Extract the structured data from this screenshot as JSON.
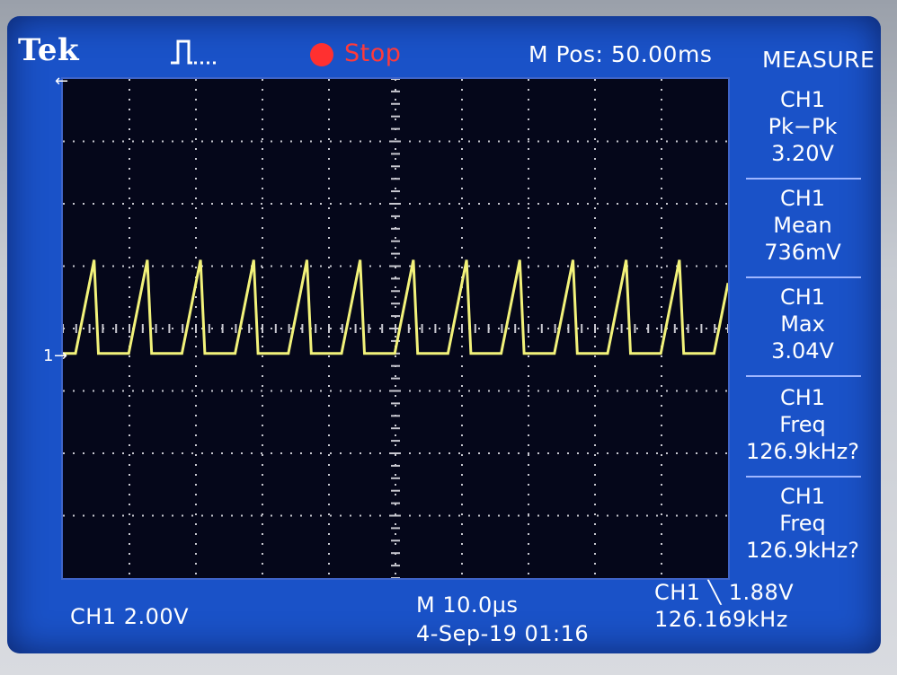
{
  "header": {
    "brand": "Tek",
    "trigger_icon": "pulse-trigger-icon",
    "run_status": "Stop",
    "m_pos": "M Pos: 50.00ms",
    "menu_title": "MEASURE"
  },
  "colors": {
    "screen": "#1a52c8",
    "grid_bg": "#05071a",
    "trace": "#f2f27a",
    "stop": "#ff3030"
  },
  "measurements": [
    {
      "channel": "CH1",
      "type": "Pk−Pk",
      "value": "3.20V"
    },
    {
      "channel": "CH1",
      "type": "Mean",
      "value": "736mV"
    },
    {
      "channel": "CH1",
      "type": "Max",
      "value": "3.04V"
    },
    {
      "channel": "CH1",
      "type": "Freq",
      "value": "126.9kHz?"
    },
    {
      "channel": "CH1",
      "type": "Freq",
      "value": "126.9kHz?"
    }
  ],
  "markers": {
    "ch1_ground": "1→",
    "trigger_pos": "←"
  },
  "footer": {
    "channel_scale": "CH1  2.00V",
    "timebase": "M 10.0µs",
    "date_time": "4-Sep-19 01:16",
    "trigger_info": "CH1 ╲ 1.88V",
    "trigger_freq": "126.169kHz"
  },
  "waveform": {
    "pulse_count": 13,
    "low_level_div": 0,
    "high_level_div": 1.5
  }
}
